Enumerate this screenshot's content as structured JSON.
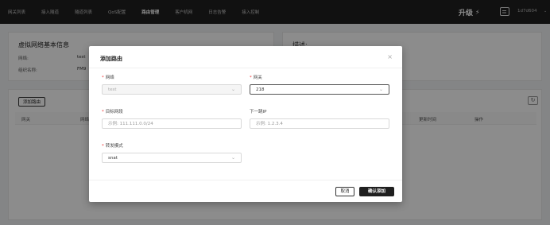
{
  "nav": {
    "tabs": [
      {
        "label": "网关列表"
      },
      {
        "label": "接入隧道"
      },
      {
        "label": "隧道列表"
      },
      {
        "label": "QoS配置"
      },
      {
        "label": "路由管理"
      },
      {
        "label": "客户机网"
      },
      {
        "label": "日志告警"
      },
      {
        "label": "接入控制"
      }
    ],
    "active_tab": "路由管理",
    "upgrade_label": "升级",
    "username": "1d7d604"
  },
  "info_card": {
    "title": "虚拟网络基本信息",
    "rows": [
      {
        "label": "网络:",
        "value": "test"
      },
      {
        "label": "组织名称:",
        "value": "FM9"
      }
    ]
  },
  "right_card": {
    "title": "描述:"
  },
  "table": {
    "add_button": "添加路由",
    "refresh_icon": "↻",
    "columns": [
      "网关",
      "网络",
      "更新时间",
      "操作"
    ]
  },
  "modal": {
    "title": "添加路由",
    "close_icon": "×",
    "network": {
      "label": "网络",
      "value": "test"
    },
    "gateway": {
      "label": "网关",
      "value": "218"
    },
    "target": {
      "label": "目标网段",
      "placeholder": "示例: 111.111.0.0/24"
    },
    "next_hop": {
      "label": "下一跳IP",
      "placeholder": "示例: 1.2.3.4"
    },
    "forward_mode": {
      "label": "转发模式",
      "value": "snat"
    },
    "cancel_label": "取消",
    "confirm_label": "确认添加"
  }
}
